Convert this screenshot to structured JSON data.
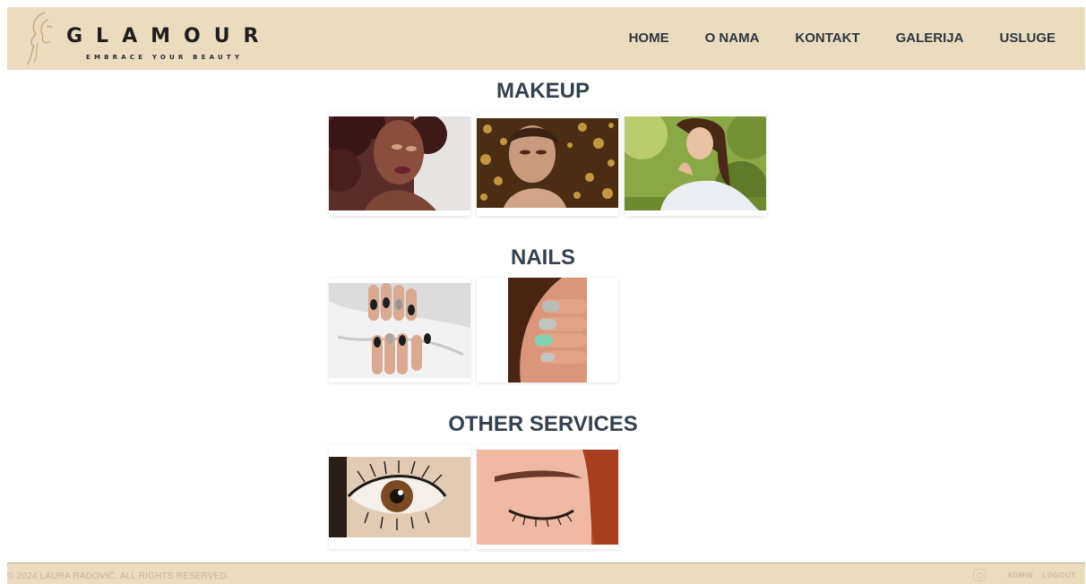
{
  "brand": {
    "title": "GLAMOUR",
    "tagline": "EMBRACE YOUR BEAUTY"
  },
  "nav": {
    "items": [
      "HOME",
      "O NAMA",
      "KONTAKT",
      "GALERIJA",
      "USLUGE"
    ]
  },
  "sections": [
    {
      "title": "MAKEUP"
    },
    {
      "title": "NAILS"
    },
    {
      "title": "OTHER SERVICES"
    }
  ],
  "footer": {
    "copyright": "© 2024 LAURA RADOVIĆ. ALL RIGHTS RESERVED.",
    "admin": "ADMIN",
    "logout": "LOGOUT",
    "icon": "instagram-icon"
  },
  "colors": {
    "header_bg": "#ecdcbf",
    "text": "#34414f"
  }
}
